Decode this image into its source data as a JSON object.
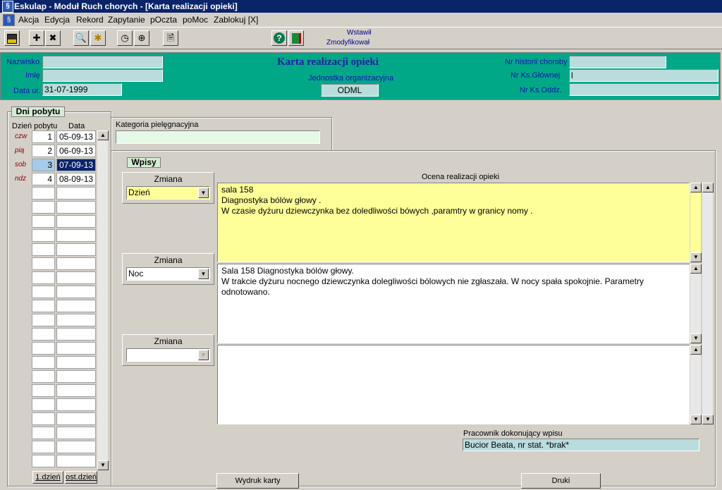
{
  "window": {
    "title": "Eskulap - Moduł Ruch chorych - [Karta realizacji opieki]"
  },
  "menu": [
    "Akcja",
    "Edycja",
    "Rekord",
    "Zapytanie",
    "pOczta",
    "poMoc",
    "Zablokuj [X]"
  ],
  "toolbar": {
    "status_inserted": "Wstawił",
    "status_modified": "Zmodyfikował"
  },
  "header": {
    "title": "Karta realizacji opieki",
    "surname_label": "Nazwisko",
    "surname_value": "",
    "name_label": "Imię",
    "name_value": "",
    "birthdate_label": "Data ur.",
    "birthdate_value": "31-07-1999",
    "unit_label": "Jednostka organizacyjna",
    "unit_value": "ODML",
    "history_label": "Nr historii choroby",
    "history_value": "",
    "main_book_label": "Nr Ks.Głównej",
    "main_book_value": "l",
    "ward_book_label": "Nr Ks.Oddz.",
    "ward_book_value": ""
  },
  "stay": {
    "tab": "Dni pobytu",
    "col_day": "Dzień pobytu",
    "col_date": "Data",
    "rows": [
      {
        "weekday": "czw",
        "day": "1",
        "date": "05-09-13"
      },
      {
        "weekday": "pią",
        "day": "2",
        "date": "06-09-13"
      },
      {
        "weekday": "sob",
        "day": "3",
        "date": "07-09-13"
      },
      {
        "weekday": "ndz",
        "day": "4",
        "date": "08-09-13"
      }
    ],
    "first_day_button": "1.dzień",
    "last_day_button": "ost.dzień"
  },
  "category": {
    "label": "Kategoria pielęgnacyjna",
    "value": ""
  },
  "entries": {
    "tab": "Wpisy",
    "assessment_header": "Ocena realizacji opieki",
    "shift_label": "Zmiana",
    "items": [
      {
        "shift": "Dzień",
        "text": "sala 158\nDiagnostyka bólów głowy .\nW czasie dyżuru dziewczynka bez doledliwości bówych ,paramtry w granicy nomy ."
      },
      {
        "shift": "Noc",
        "text": "Sala 158 Diagnostyka bólów głowy.\nW trakcie dyżuru nocnego dziewczynka dolegliwości bólowych nie zgłaszała. W nocy spała spokojnie. Parametry\nodnotowano."
      },
      {
        "shift": "",
        "text": ""
      }
    ],
    "worker_label": "Pracownik dokonujący wpisu",
    "worker_value": "Bucior Beata, nr stat. *brak*"
  },
  "buttons": {
    "print_card": "Wydruk karty",
    "prints": "Druki"
  },
  "colors": {
    "header_bg": "#00a888",
    "field_bg": "#b9dcdc",
    "day_memo_bg": "#ffff99",
    "title_bar": "#0a246a"
  }
}
